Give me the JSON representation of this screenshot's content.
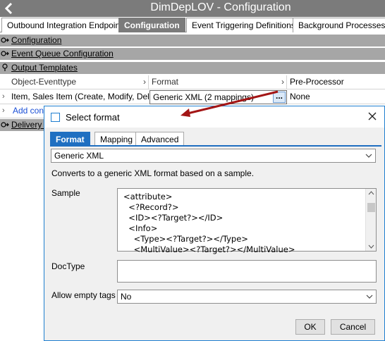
{
  "window": {
    "title": "DimDepLOV - Configuration"
  },
  "tabs": [
    {
      "label": "Outbound Integration Endpoint",
      "active": false
    },
    {
      "label": "Configuration",
      "active": true
    },
    {
      "label": "Event Triggering Definitions",
      "active": false
    },
    {
      "label": "Background Processes",
      "active": false
    }
  ],
  "sections": {
    "configuration": "Configuration",
    "event_queue": "Event Queue Configuration",
    "output_templates": "Output Templates",
    "delivery": "Delivery M"
  },
  "grid": {
    "columns": [
      "Object-Eventtype",
      "Format",
      "Pre-Processor"
    ],
    "row": {
      "object_eventtype": "Item, Sales Item (Create, Modify, Del...",
      "format": "Generic XML (2 mappings)",
      "ellipsis": "...",
      "pre_processor": "None"
    },
    "add_link": "Add cont"
  },
  "dialog": {
    "title": "Select format",
    "tabs": [
      "Format",
      "Mapping",
      "Advanced"
    ],
    "active_tab": "Format",
    "format_select": "Generic XML",
    "description": "Converts to a generic XML format based on a sample.",
    "sample_label": "Sample",
    "sample_lines": [
      "<attribute>",
      "  <?Record?>",
      "  <ID><?Target?></ID>",
      "  <Info>",
      "    <Type><?Target?></Type>",
      "    <MultiValue><?Target?></MultiValue>"
    ],
    "doctype_label": "DocType",
    "doctype_value": "",
    "allow_empty_label": "Allow empty tags",
    "allow_empty_value": "No",
    "ok": "OK",
    "cancel": "Cancel"
  },
  "colors": {
    "titlebar": "#7b7b7b",
    "section_bar": "#a6a6a6",
    "accent_blue": "#1f6fc1",
    "arrow_red": "#a31515"
  }
}
